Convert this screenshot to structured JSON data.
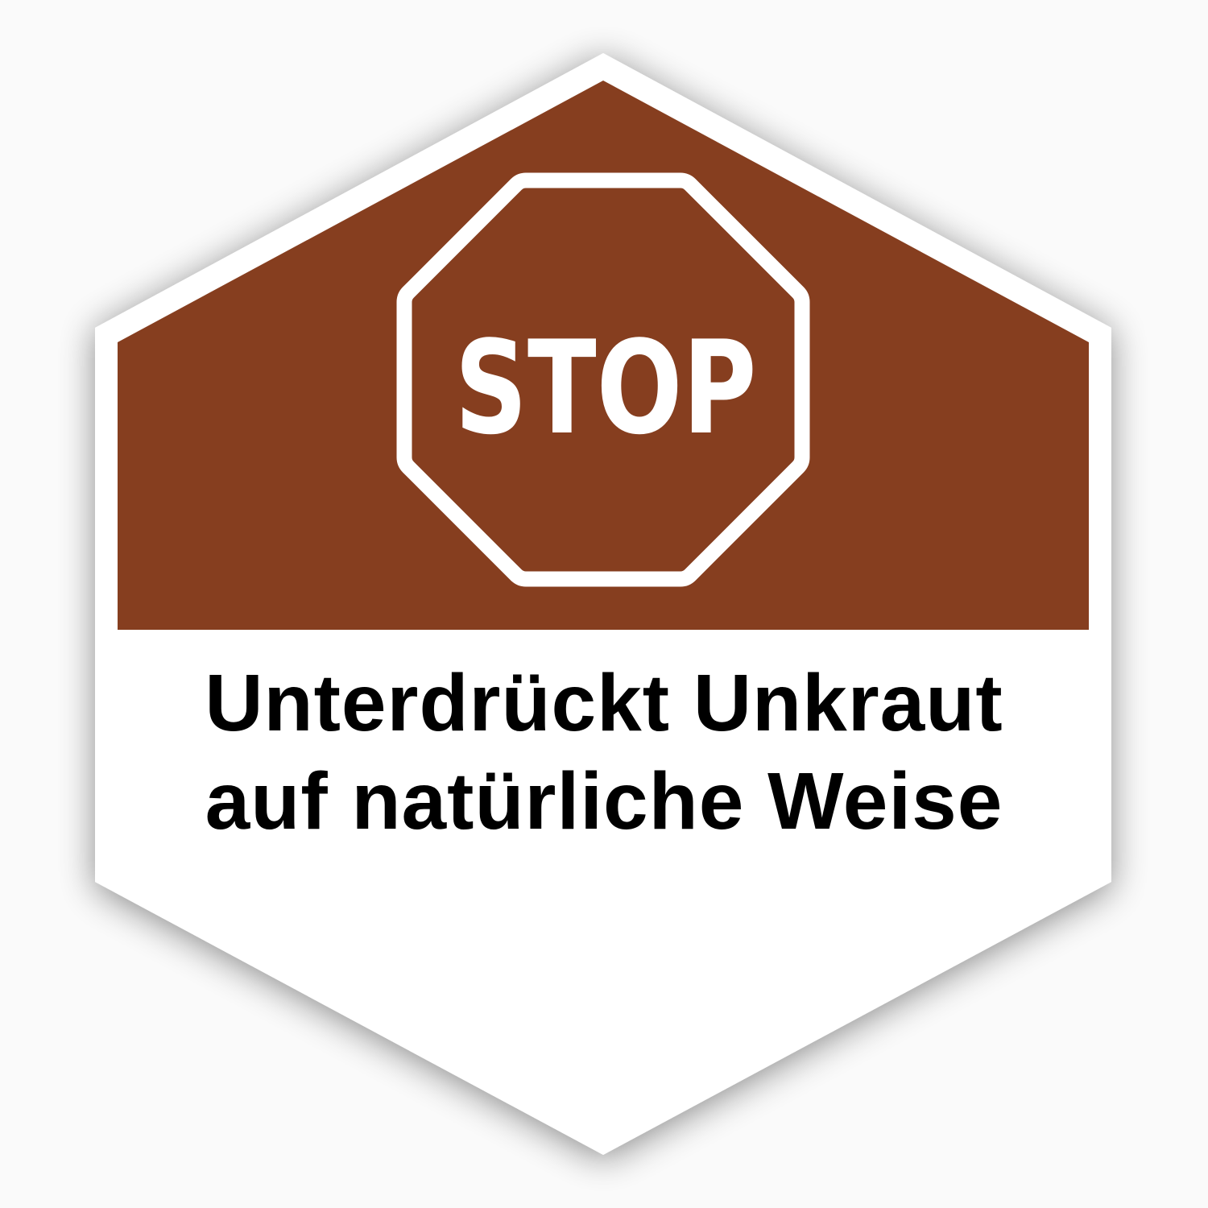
{
  "colors": {
    "background": "#fafafa",
    "badge_fill": "#ffffff",
    "band_brown": "#863e1f",
    "stop_outline": "#ffffff",
    "caption_text": "#000000"
  },
  "icon": "stop-sign-icon",
  "stop_label": "STOP",
  "caption": {
    "line1": "Unterdrückt Unkraut",
    "line2": "auf natürliche Weise"
  }
}
